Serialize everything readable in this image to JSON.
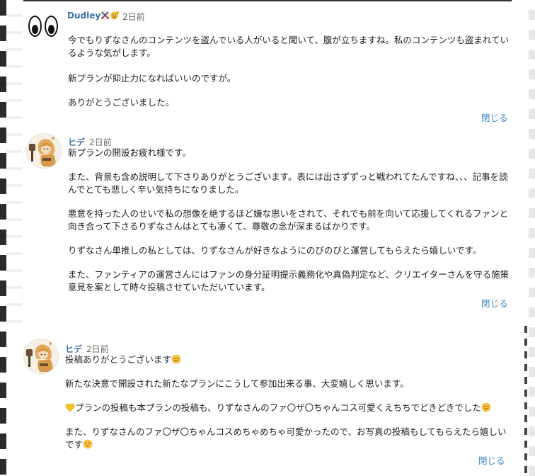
{
  "comments": [
    {
      "author": "Dudley",
      "time": "2日前",
      "avatar_icon": "googly-eyes-icon",
      "name_badges": [
        "crossed-swords-icon",
        "waving-face-icon"
      ],
      "paragraphs": [
        "今でもりずなさんのコンテンツを盗んでいる人がいると聞いて、腹が立ちますね。私のコンテンツも盗まれているような気がします。",
        "新プランが抑止力になればいいのですが。",
        "ありがとうございました。"
      ],
      "close_label": "閉じる"
    },
    {
      "author": "ヒデ",
      "time": "2日前",
      "avatar_icon": "character-avatar-icon",
      "paragraphs": [
        "新プランの開設お疲れ様です。",
        "また、背景も含め説明して下さりありがとうございます。表には出さずずっと戦われてたんですね、、、記事を読んでとても悲しく辛い気持ちになりました。",
        "悪意を持った人のせいで私の想像を絶するほど嫌な思いをされて、それでも前を向いて応援してくれるファンと向き合って下さるりずなさんはとても凄くて、尊敬の念が深まるばかりです。",
        "りずなさん単推しの私としては、りずなさんが好きなようにのびのびと運営してもらえたら嬉しいです。",
        "また、ファンティアの運営さんにはファンの身分証明提示義務化や真偽判定など、クリエイターさんを守る施策意見を案として時々投稿させていただいています。"
      ],
      "close_label": "閉じる"
    },
    {
      "author": "ヒデ",
      "time": "2日前",
      "avatar_icon": "character-avatar-icon",
      "paragraphs": [
        "投稿ありがとうございます",
        "新たな決意で開設された新たなプランにこうして参加出来る事、大変嬉しく思います。",
        "プランの投稿も本プランの投稿も、りずなさんのファ〇ザ〇ちゃんコス可愛くえちちでどきどきでした",
        "また、りずなさんのファ〇ザ〇ちゃんコスめちゃめちゃ可愛かったので、お写真の投稿もしてもらえたら嬉しいです"
      ],
      "inline_emoji": [
        "smiling-face-icon",
        "yellow-heart-icon",
        "heart-eyes-face-icon",
        "heart-eyes-face-icon"
      ],
      "close_label": "閉じる"
    }
  ],
  "colors": {
    "name": "#3d6fa8",
    "link": "#3b86c6",
    "text": "#222222",
    "muted": "#666666"
  }
}
